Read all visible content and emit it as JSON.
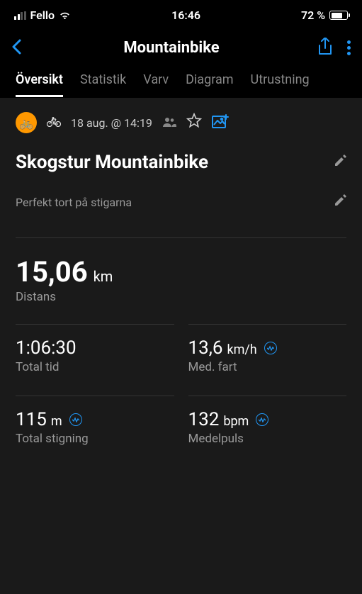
{
  "status": {
    "carrier": "Fello",
    "time": "16:46",
    "battery": "72 %"
  },
  "header": {
    "title": "Mountainbike"
  },
  "tabs": {
    "overview": "Översikt",
    "stats": "Statistik",
    "laps": "Varv",
    "charts": "Diagram",
    "gear": "Utrustning"
  },
  "activity": {
    "date": "18 aug. @ 14:19",
    "title": "Skogstur Mountainbike",
    "note": "Perfekt tort på stigarna"
  },
  "distance": {
    "value": "15,06",
    "unit": "km",
    "label": "Distans"
  },
  "stats": {
    "time": {
      "value": "1:06:30",
      "label": "Total tid"
    },
    "speed": {
      "value": "13,6",
      "unit": "km/h",
      "label": "Med. fart"
    },
    "elevation": {
      "value": "115",
      "unit": "m",
      "label": "Total stigning"
    },
    "hr": {
      "value": "132",
      "unit": "bpm",
      "label": "Medelpuls"
    }
  }
}
